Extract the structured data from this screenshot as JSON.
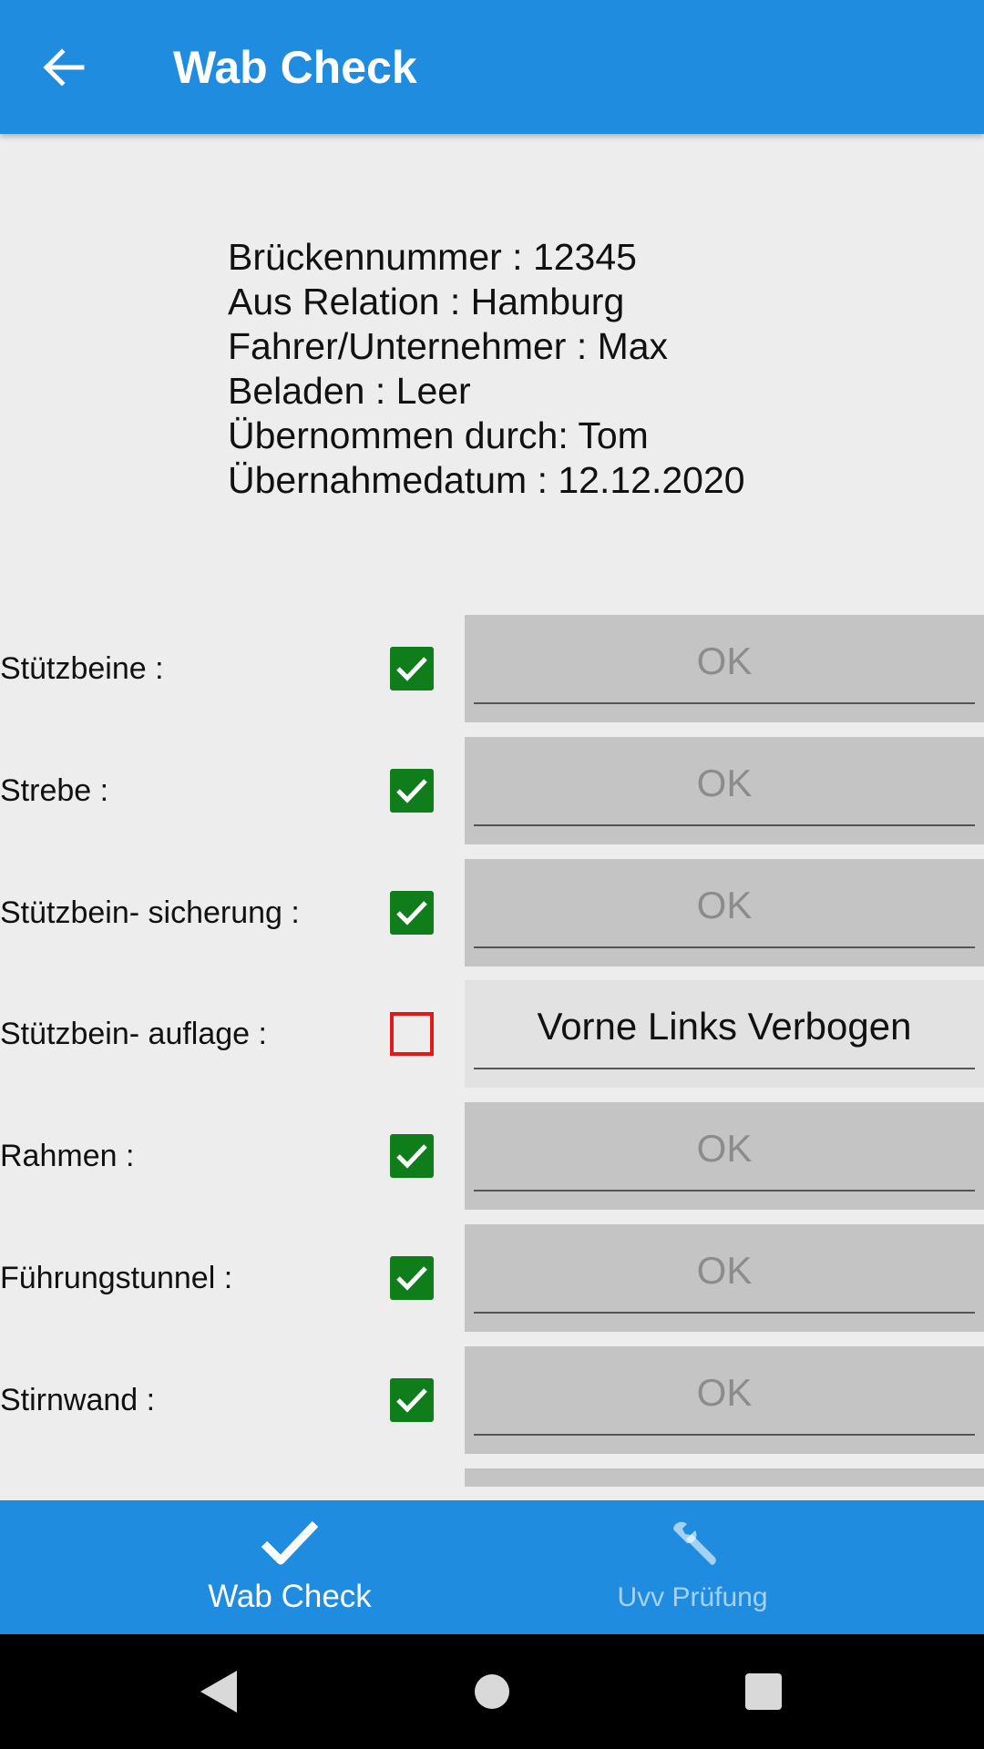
{
  "appbar": {
    "title": "Wab Check",
    "back_icon": "arrow-left-icon"
  },
  "info": {
    "lines": [
      "Brückennummer : 12345",
      "Aus Relation : Hamburg",
      "Fahrer/Unternehmer : Max",
      "Beladen : Leer",
      "Übernommen durch: Tom",
      "Übernahmedatum : 12.12.2020"
    ]
  },
  "checklist": [
    {
      "label": "Stützbeine :",
      "checked": true,
      "value": "OK"
    },
    {
      "label": "Strebe :",
      "checked": true,
      "value": "OK"
    },
    {
      "label": "Stützbein- sicherung :",
      "checked": true,
      "value": "OK"
    },
    {
      "label": "Stützbein- auflage :",
      "checked": false,
      "value": "Vorne Links Verbogen"
    },
    {
      "label": "Rahmen :",
      "checked": true,
      "value": "OK"
    },
    {
      "label": "Führungstunnel :",
      "checked": true,
      "value": "OK"
    },
    {
      "label": "Stirnwand :",
      "checked": true,
      "value": "OK"
    }
  ],
  "bottom_nav": [
    {
      "label": "Wab Check",
      "icon": "check-icon",
      "active": true
    },
    {
      "label": "Uvv Prüfung",
      "icon": "wrench-icon",
      "active": false
    }
  ],
  "colors": {
    "primary": "#1f8ce0",
    "checked": "#0e7d1a",
    "unchecked": "#e01919",
    "background": "#ededed"
  }
}
